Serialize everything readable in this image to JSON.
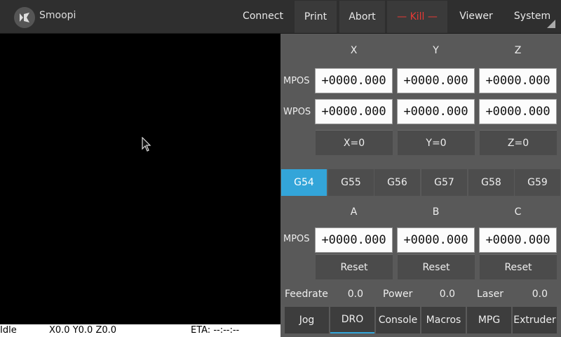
{
  "app": {
    "title": "Smoopi",
    "logo_icon": "kivy-logo-icon"
  },
  "toolbar": {
    "connect": "Connect",
    "print": "Print",
    "abort": "Abort",
    "kill": "— Kill —",
    "viewer": "Viewer",
    "system": "System"
  },
  "status": {
    "state": "Idle",
    "position": "X0.0 Y0.0 Z0.0",
    "eta": "ETA: --:--:--"
  },
  "dro": {
    "axes_xyz": [
      "X",
      "Y",
      "Z"
    ],
    "mpos_label": "MPOS",
    "wpos_label": "WPOS",
    "mpos_xyz": [
      "+0000.000",
      "+0000.000",
      "+0000.000"
    ],
    "wpos_xyz": [
      "+0000.000",
      "+0000.000",
      "+0000.000"
    ],
    "zero_buttons": [
      "X=0",
      "Y=0",
      "Z=0"
    ],
    "wcs": [
      "G54",
      "G55",
      "G56",
      "G57",
      "G58",
      "G59"
    ],
    "wcs_active": "G54",
    "axes_abc": [
      "A",
      "B",
      "C"
    ],
    "mpos_abc": [
      "+0000.000",
      "+0000.000",
      "+0000.000"
    ],
    "reset_buttons": [
      "Reset",
      "Reset",
      "Reset"
    ]
  },
  "stats": {
    "feedrate_label": "Feedrate",
    "feedrate": "0.0",
    "power_label": "Power",
    "power": "0.0",
    "laser_label": "Laser",
    "laser": "0.0"
  },
  "tabs": [
    "Jog",
    "DRO",
    "Console",
    "Macros",
    "MPG",
    "Extruder"
  ],
  "tab_active": "DRO",
  "colors": {
    "accent": "#33a5d9",
    "kill": "#e53935"
  }
}
